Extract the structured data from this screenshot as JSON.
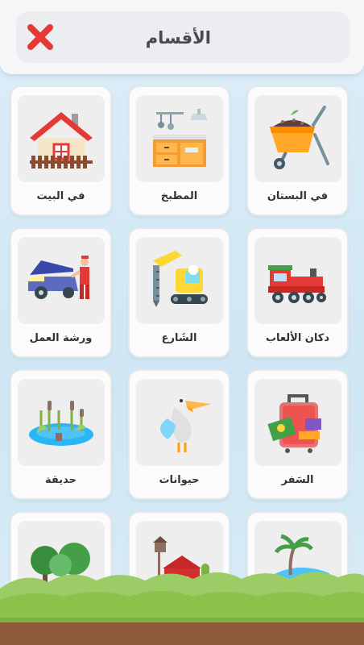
{
  "header": {
    "title": "الأقسام",
    "close_icon": "close-x-icon",
    "close_color": "#e53935"
  },
  "categories": [
    {
      "label": "في البستان",
      "icon": "wheelbarrow-icon"
    },
    {
      "label": "المطبخ",
      "icon": "kitchen-icon"
    },
    {
      "label": "في البيت",
      "icon": "house-icon"
    },
    {
      "label": "دكان الألعاب",
      "icon": "toy-train-icon"
    },
    {
      "label": "الشَارع",
      "icon": "excavator-icon"
    },
    {
      "label": "ورشة العمل",
      "icon": "mechanic-car-icon"
    },
    {
      "label": "السَفر",
      "icon": "suitcase-icon"
    },
    {
      "label": "حيوانات",
      "icon": "pelican-icon"
    },
    {
      "label": "حديقة",
      "icon": "pond-reeds-icon"
    },
    {
      "label": "",
      "icon": "beach-palm-icon"
    },
    {
      "label": "",
      "icon": "barn-farm-icon"
    },
    {
      "label": "",
      "icon": "trees-icon"
    }
  ]
}
